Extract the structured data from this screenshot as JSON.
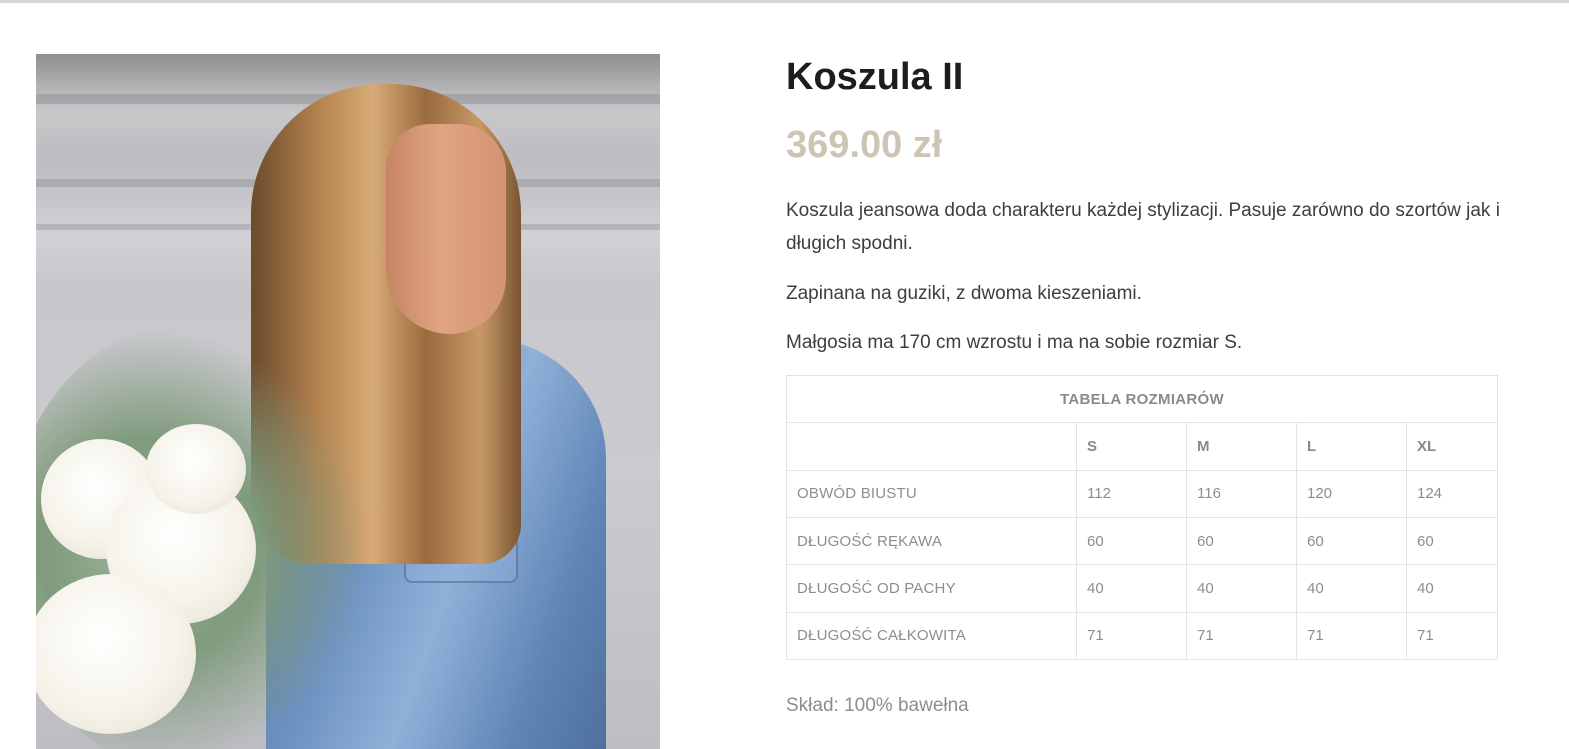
{
  "product": {
    "title": "Koszula II",
    "price": "369.00 zł",
    "description": [
      "Koszula jeansowa doda charakteru każdej stylizacji. Pasuje zarówno do szortów jak i długich spodni.",
      "Zapinana na guziki, z dwoma kieszeniami.",
      "Małgosia ma 170 cm wzrostu i ma na sobie rozmiar S."
    ],
    "composition": "Skład: 100% bawełna"
  },
  "size_table": {
    "caption": "TABELA ROZMIARÓW",
    "sizes": [
      "S",
      "M",
      "L",
      "XL"
    ],
    "rows": [
      {
        "label": "OBWÓD BIUSTU",
        "values": [
          "112",
          "116",
          "120",
          "124"
        ]
      },
      {
        "label": "DŁUGOŚĆ RĘKAWA",
        "values": [
          "60",
          "60",
          "60",
          "60"
        ]
      },
      {
        "label": "DŁUGOŚĆ OD PACHY",
        "values": [
          "40",
          "40",
          "40",
          "40"
        ]
      },
      {
        "label": "DŁUGOŚĆ CAŁKOWITA",
        "values": [
          "71",
          "71",
          "71",
          "71"
        ]
      }
    ]
  },
  "colors": {
    "price": "#cdc4b4",
    "title": "#1d1d1f",
    "table_border": "#e3e3e6",
    "muted_text": "#8d8d90"
  }
}
